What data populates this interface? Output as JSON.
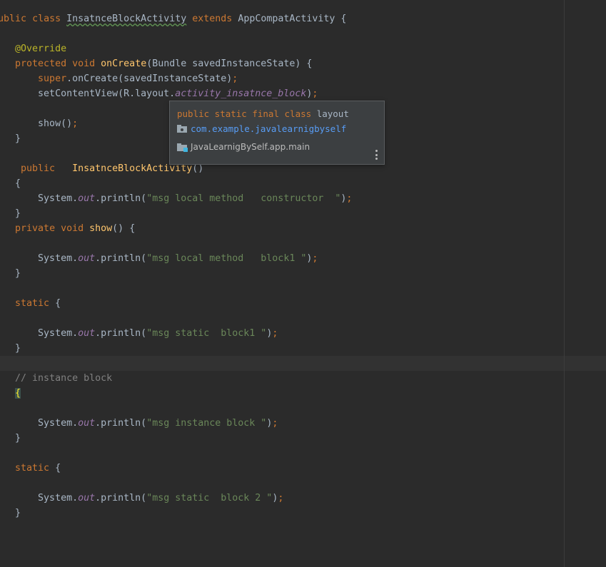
{
  "colors": {
    "background": "#2b2b2b",
    "keyword": "#cc7832",
    "annotation": "#bbb529",
    "method": "#ffc66d",
    "string": "#6a8759",
    "static_field": "#9876aa",
    "comment": "#808080",
    "plain": "#a9b7c6",
    "popup_background": "#3c3f41",
    "link": "#589df6"
  },
  "code": {
    "class_decl": {
      "kw1": "public",
      "kw2": "class",
      "name": "InsatnceBlockActivity",
      "kw3": "extends",
      "parent": "AppCompatActivity",
      "brace": "{"
    },
    "override": "@Override",
    "oncreate": {
      "kw1": "protected",
      "kw2": "void",
      "name": "onCreate",
      "params": "(Bundle savedInstanceState) {"
    },
    "super_call": {
      "kw": "super",
      "rest": ".onCreate(savedInstanceState)",
      "semi": ";"
    },
    "set_content": {
      "pre": "setContentView(R.layout.",
      "field": "activity_insatnce_block",
      "post": ")",
      "semi": ";"
    },
    "show_call": {
      "text": "show()",
      "semi": ";"
    },
    "close_brace": "}",
    "open_brace": "{",
    "constructor_decl": {
      "kw": "public",
      "name": "InsatnceBlockActivity",
      "parens": "()"
    },
    "println_prefix": "System.",
    "println_field": "out",
    "println_method": ".println(",
    "println_suffix": ")",
    "semi": ";",
    "msg_constructor": "\"msg local method   constructor  \"",
    "show_decl": {
      "kw1": "private",
      "kw2": "void",
      "name": "show",
      "rest": "() {"
    },
    "msg_block1": "\"msg local method   block1 \"",
    "static_kw": "static",
    "static_brace": "{",
    "msg_static1": "\"msg static  block1 \"",
    "comment_instance": "// instance block",
    "msg_instance": "\"msg instance block \"",
    "msg_static2": "\"msg static  block 2 \""
  },
  "popup": {
    "signature_kw": "public static final class",
    "signature_name": "layout",
    "package_icon": "package-folder-icon",
    "package": "com.example.javalearnigbyself",
    "module_icon": "module-folder-icon",
    "module": "JavaLearnigBySelf.app.main",
    "more_icon": "vertical-ellipsis-icon"
  }
}
